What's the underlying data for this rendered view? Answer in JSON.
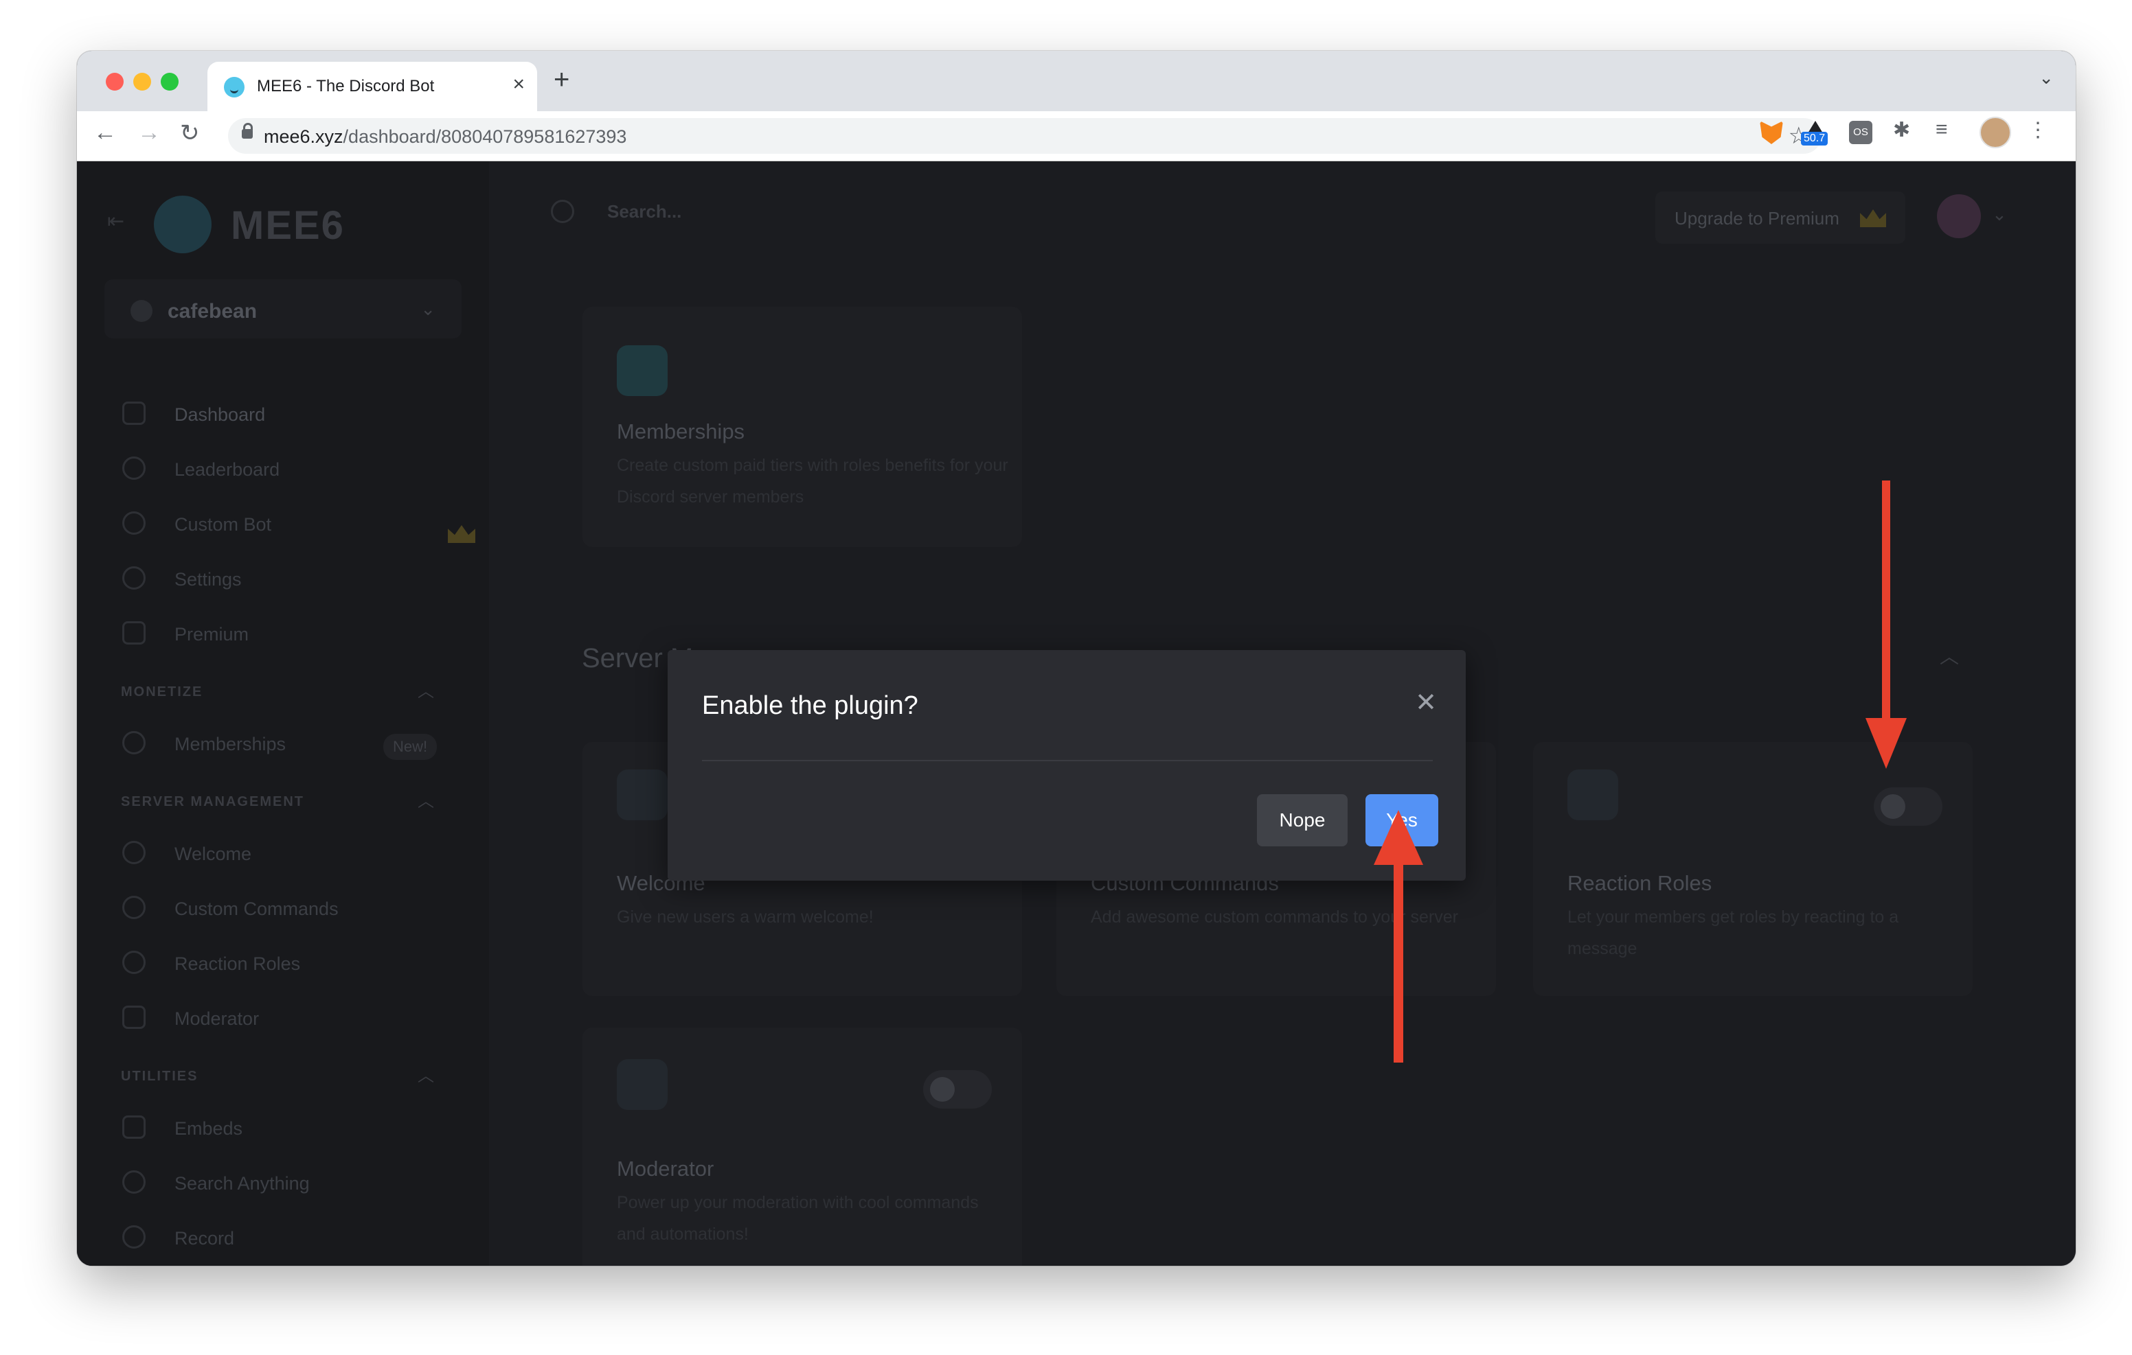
{
  "browser": {
    "tab_title": "MEE6 - The Discord Bot",
    "url_host": "mee6.xyz",
    "url_path": "/dashboard/808040789581627393",
    "extension_badge": "50.7",
    "extension_os_label": "OS"
  },
  "app": {
    "logo": "MEE6",
    "search_placeholder": "Search...",
    "upgrade_label": "Upgrade to Premium",
    "server_name": "cafebean",
    "nav": {
      "main": [
        "Dashboard",
        "Leaderboard",
        "Custom Bot",
        "Settings",
        "Premium"
      ],
      "monetize_header": "MONETIZE",
      "monetize": [
        "Memberships"
      ],
      "new_badge": "New!",
      "server_management_header": "SERVER MANAGEMENT",
      "server_management": [
        "Welcome",
        "Custom Commands",
        "Reaction Roles",
        "Moderator"
      ],
      "utilities_header": "UTILITIES",
      "utilities": [
        "Embeds",
        "Search Anything",
        "Record"
      ]
    },
    "section_title": "Server M",
    "cards": {
      "memberships": {
        "title": "Memberships",
        "desc": "Create custom paid tiers with roles benefits for your Discord server members"
      },
      "welcome": {
        "title": "Welcome",
        "desc": "Give new users a warm welcome!"
      },
      "custom_commands": {
        "title": "Custom Commands",
        "desc": "Add awesome custom commands to your server"
      },
      "reaction_roles": {
        "title": "Reaction Roles",
        "desc": "Let your members get roles by reacting to a message"
      },
      "moderator": {
        "title": "Moderator",
        "desc": "Power up your moderation with cool commands and automations!"
      }
    }
  },
  "modal": {
    "title": "Enable the plugin?",
    "nope_label": "Nope",
    "yes_label": "Yes"
  },
  "colors": {
    "yes_button": "#5492f5",
    "annotation_arrow": "#e8412d"
  }
}
